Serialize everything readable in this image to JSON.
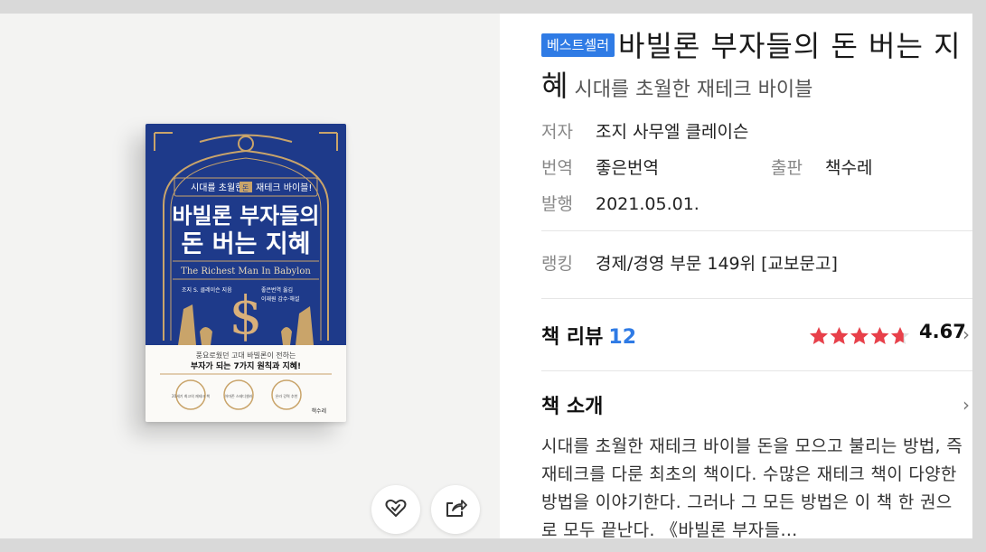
{
  "colors": {
    "accent": "#2f7be5",
    "star": "#e8404a",
    "cover_blue": "#1e3a8a",
    "cover_gold": "#c9a46a"
  },
  "cover": {
    "top_line": "시대를 초월한",
    "top_line_tag": "돈",
    "top_line_end": "재테크 바이블!",
    "title_line1": "바빌론 부자들의",
    "title_line2": "돈 버는 지혜",
    "english_title": "The Richest Man In Babylon",
    "author_credit": "조지 S. 클레이슨 지음",
    "translator_credit": "좋은번역 옮김",
    "editor_credit": "이재원 감수·해설",
    "blurb_line1": "풍요로웠던 고대 바빌론이 전하는",
    "blurb_line2": "부자가 되는 7가지 원칙과 지혜!",
    "seal1": "20세기 최고의 재테크 책",
    "seal2": "아마존 스테디셀러",
    "seal3": "온라 강력 추천",
    "publisher_mark": "책수레"
  },
  "badge": "베스트셀러",
  "title": "바빌론 부자들의 돈 버는 지혜",
  "subtitle": "시대를 초월한 재테크 바이블",
  "meta": {
    "author_label": "저자",
    "author": "조지 사무엘 클레이슨",
    "translator_label": "번역",
    "translator": "좋은번역",
    "publisher_label": "출판",
    "publisher": "책수레",
    "date_label": "발행",
    "date": "2021.05.01.",
    "ranking_label": "랭킹",
    "ranking": "경제/경영 부문 149위 [교보문고]"
  },
  "review": {
    "label": "책 리뷰",
    "count": "12",
    "rating": "4.67",
    "rating_value": 4.67
  },
  "intro": {
    "label": "책 소개",
    "text": "시대를 초월한 재테크 바이블 돈을 모으고 불리는 방법, 즉 재테크를 다룬 최초의 책이다. 수많은 재테크 책이 다양한 방법을 이야기한다. 그러나 그 모든 방법은 이 책 한 권으로 모두 끝난다. 《바빌론 부자들…"
  },
  "icons": {
    "wishlist": "heart-check-icon",
    "share": "share-icon",
    "chevron": "chevron-right-icon"
  }
}
